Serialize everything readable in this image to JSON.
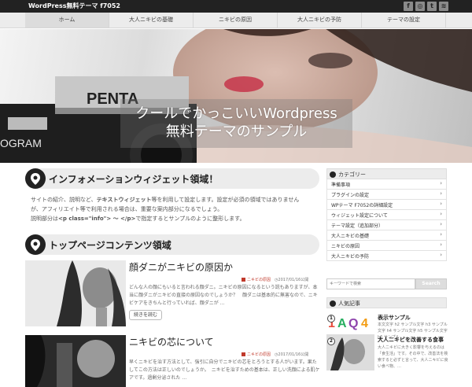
{
  "site": {
    "title": "WordPress無料テーマ f7052"
  },
  "social": [
    {
      "icon": "facebook-icon",
      "glyph": "f"
    },
    {
      "icon": "instagram-icon",
      "glyph": "◎"
    },
    {
      "icon": "twitter-icon",
      "glyph": "t"
    },
    {
      "icon": "rss-icon",
      "glyph": "≋"
    }
  ],
  "nav": {
    "items": [
      {
        "label": "ホーム",
        "active": true
      },
      {
        "label": "大人ニキビの基礎"
      },
      {
        "label": "ニキビの原因"
      },
      {
        "label": "大人ニキビの予防"
      },
      {
        "label": "テーマの設定"
      }
    ]
  },
  "hero": {
    "line1": "クールでかっこいいWordpress",
    "line2": "無料テーマのサンプル"
  },
  "info": {
    "title": "インフォメーションウィジェット領域！",
    "line1_pre": "サイトの紹介、説明など、",
    "line1_bold": "テキストウィジェット",
    "line1_post": "等を利用して設定します。設定が必須の領域ではありません",
    "line2": "が、アフィリエイト等で利用される場合は、重要な案内部分になるでしょう。",
    "line3_pre": "説明部分は",
    "line3_code": "<p class=\"info\"> 〜 </p>",
    "line3_post": "で指定するとサンプルのように整形します。"
  },
  "top": {
    "title": "トップページコンテンツ領域"
  },
  "posts": [
    {
      "title": "顔ダニがニキビの原因か",
      "category": "ニキビの原因",
      "date": "2017/01/16公開",
      "excerpt": "どんな人の顔にもいると言われる顔ダニ。ニキビの原因になるという説もありますが、本当に顔ダニがニキビの直接の原因なのでしょうか？　顔ダニは基本的に無害なので、ニキビケアをきちんと行っていれば、顔ダニが …",
      "read_more": "続きを読む"
    },
    {
      "title": "ニキビの芯について",
      "category": "ニキビの原因",
      "date": "2017/01/16公開",
      "excerpt": "早くニキビを治す方法として、強引に自分でニキビの芯をとろうとする人がいます。果たしてこの方法は正しいのでしょうか。　ニキビを治すための基本は、正しい洗顔による肌ケアです。過剰分泌された …"
    }
  ],
  "sidebar": {
    "categories_title": "カテゴリー",
    "categories": [
      "準備事項",
      "プラグインの設定",
      "WPテーマ F7052の詳細設定",
      "ウィジェット設定について",
      "テーマ設定（追加部分）",
      "大人ニキビの基礎",
      "ニキビの原因",
      "大人ニキビの予防"
    ],
    "search_placeholder": "キーワードで検索",
    "search_button": "Search",
    "popular_title": "人気記事",
    "popular": [
      {
        "rank": "1",
        "title": "表示サンプル",
        "text": "本文文字 h2 サンプル文字 h3 サンプル 文字 h4 サンプル文字 h5 サンプル文字 h6 サンプル …"
      },
      {
        "rank": "2",
        "title": "大人ニキビを改善する食事",
        "text": "大人ニキビに大きく影響を与えるのは「食生活」です。その中で、改善法を検索すると必ずと言って、大人ニキビに良い食べ物、…"
      }
    ]
  },
  "colors": {
    "accent": "#c0392b",
    "dark": "#222222"
  }
}
